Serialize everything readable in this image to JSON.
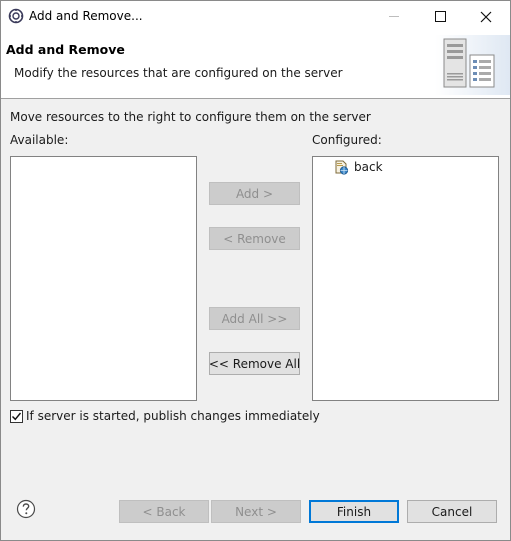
{
  "window": {
    "title": "Add and Remove..."
  },
  "banner": {
    "title": "Add and Remove",
    "description": "Modify the resources that are configured on the server",
    "icon": "server-icon"
  },
  "main": {
    "instruction": "Move resources to the right to configure them on the server",
    "available_label": "Available:",
    "configured_label": "Configured:",
    "available_items": [],
    "configured_items": [
      {
        "label": "back",
        "icon": "web-module-icon"
      }
    ]
  },
  "buttons": {
    "add": "Add >",
    "remove": "< Remove",
    "add_all": "Add All >>",
    "remove_all": "<< Remove All"
  },
  "publish_checkbox": {
    "label": "If server is started, publish changes immediately",
    "checked": true
  },
  "footer": {
    "back": "< Back",
    "next": "Next >",
    "finish": "Finish",
    "cancel": "Cancel"
  },
  "colors": {
    "default_button_border": "#0078d7",
    "window_background": "#f0f0f0"
  }
}
